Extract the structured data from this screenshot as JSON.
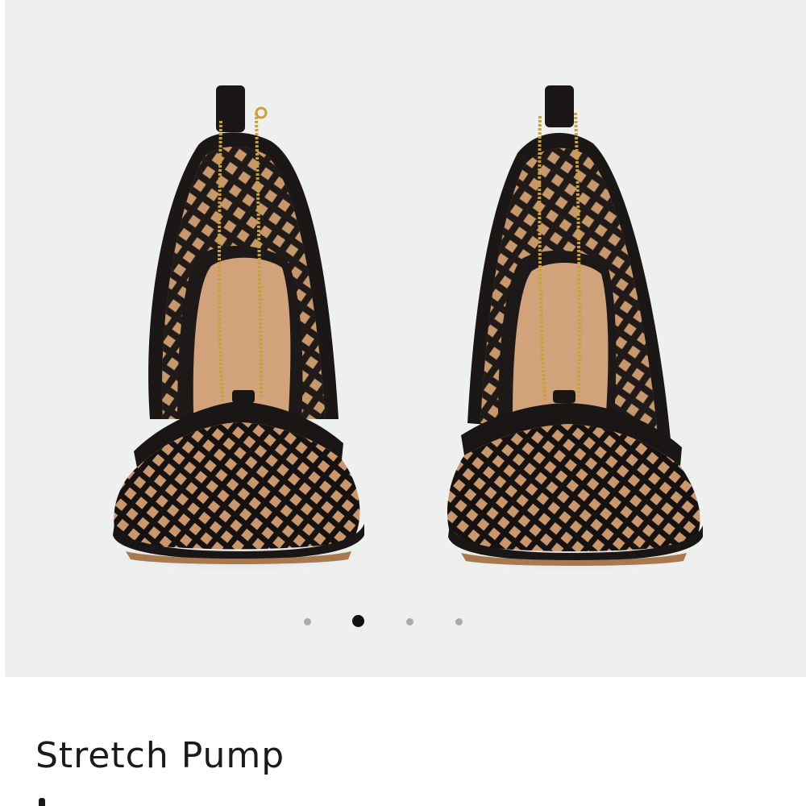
{
  "product": {
    "title": "Stretch Pump",
    "image_description_icon": "product-photo-mesh-pumps"
  },
  "gallery": {
    "slide_count": 4,
    "active_slide": 2
  },
  "colors": {
    "gallery_background": "#eef0ef",
    "dot_inactive": "#a9abaa",
    "dot_active": "#111111",
    "text": "#1a1a1a"
  }
}
